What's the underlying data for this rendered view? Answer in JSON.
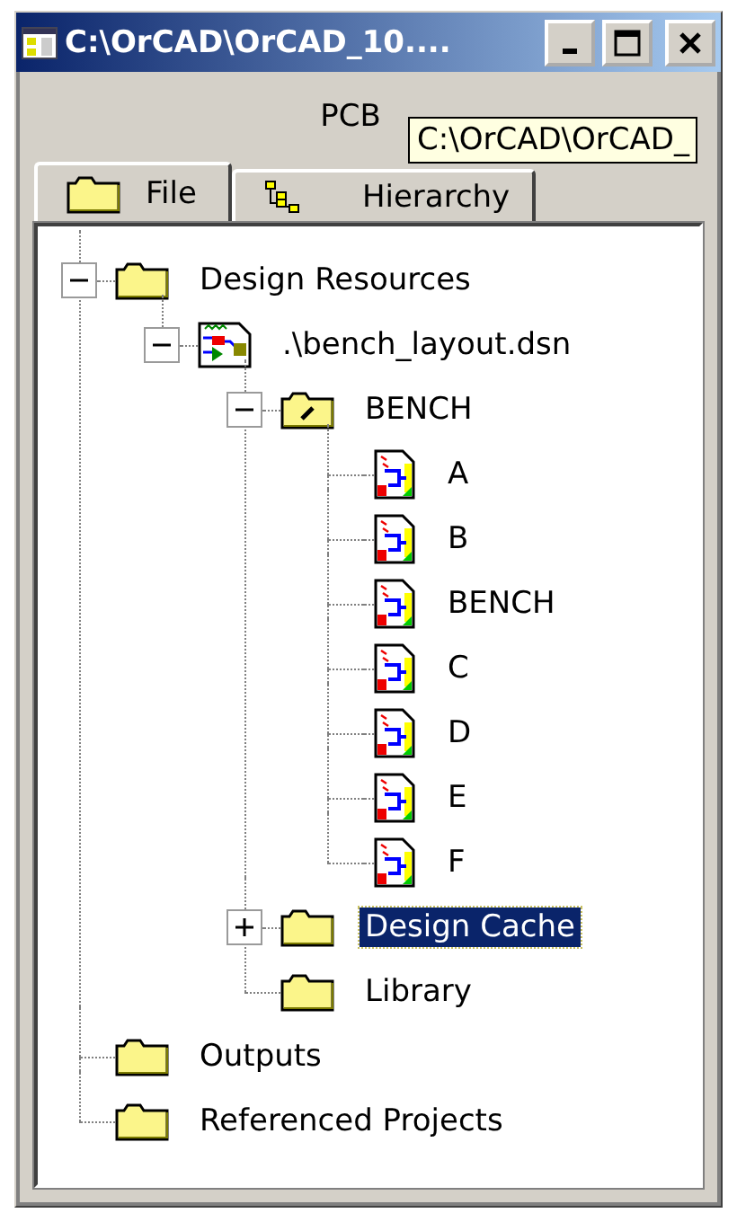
{
  "window": {
    "title": "C:\\OrCAD\\OrCAD_10...."
  },
  "header": {
    "label": "PCB"
  },
  "tooltip": {
    "text": "C:\\OrCAD\\OrCAD_"
  },
  "tabs": [
    {
      "label": "File",
      "kind": "folder",
      "selected": true
    },
    {
      "label": "Hierarchy",
      "kind": "hierarchy",
      "selected": false
    }
  ],
  "tree": [
    {
      "label": "Design Resources",
      "kind": "folder",
      "expanded": true,
      "selected": false,
      "children": [
        {
          "label": ".\\bench_layout.dsn",
          "kind": "design",
          "expanded": true,
          "selected": false,
          "children": [
            {
              "label": "BENCH",
              "kind": "schematic-folder",
              "expanded": true,
              "selected": false,
              "children": [
                {
                  "label": "A",
                  "kind": "page",
                  "selected": false
                },
                {
                  "label": "B",
                  "kind": "page",
                  "selected": false
                },
                {
                  "label": "BENCH",
                  "kind": "page",
                  "selected": false
                },
                {
                  "label": "C",
                  "kind": "page",
                  "selected": false
                },
                {
                  "label": "D",
                  "kind": "page",
                  "selected": false
                },
                {
                  "label": "E",
                  "kind": "page",
                  "selected": false
                },
                {
                  "label": "F",
                  "kind": "page",
                  "selected": false
                }
              ]
            },
            {
              "label": "Design Cache",
              "kind": "folder",
              "expanded": false,
              "selected": true
            },
            {
              "label": "Library",
              "kind": "folder",
              "selected": false
            }
          ]
        }
      ]
    },
    {
      "label": "Outputs",
      "kind": "folder",
      "selected": false
    },
    {
      "label": "Referenced Projects",
      "kind": "folder",
      "selected": false
    }
  ]
}
